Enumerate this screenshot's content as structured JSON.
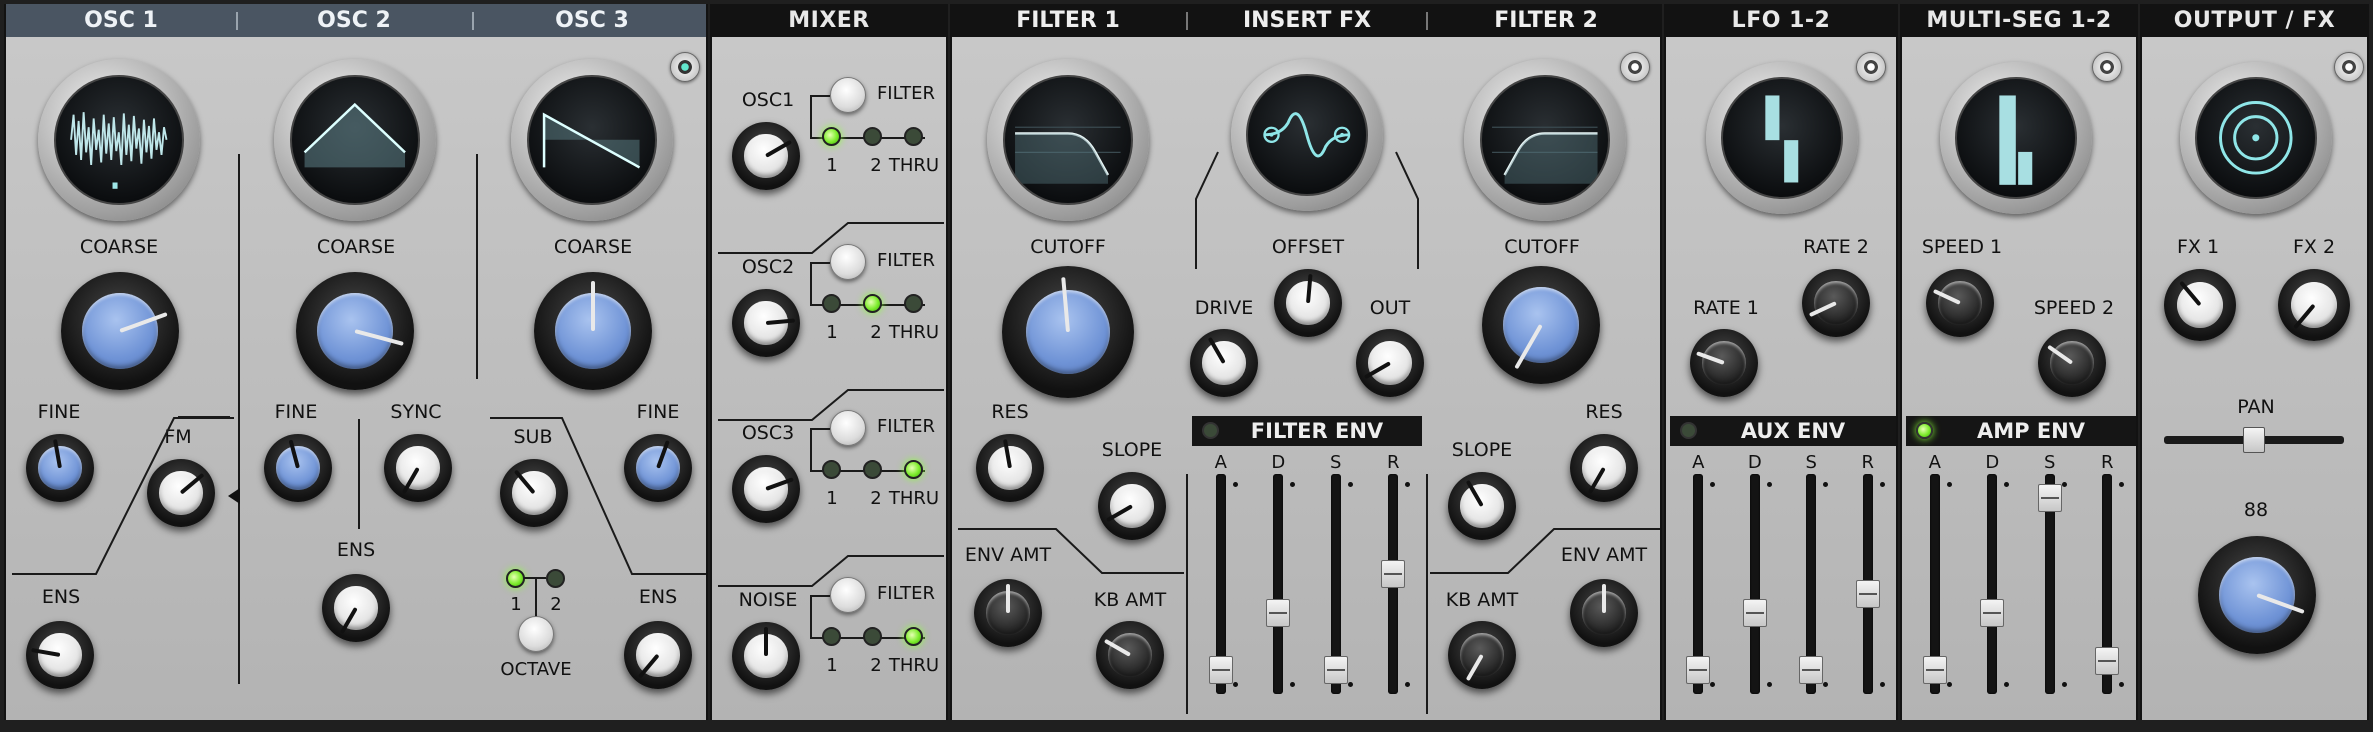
{
  "osc_header": {
    "osc1": "OSC 1",
    "osc2": "OSC 2",
    "osc3": "OSC 3"
  },
  "headers": {
    "mixer": "MIXER",
    "filter1": "FILTER 1",
    "insert_fx": "INSERT FX",
    "filter2": "FILTER 2",
    "lfo": "LFO 1-2",
    "multiseg": "MULTI-SEG 1-2",
    "output": "OUTPUT / FX"
  },
  "osc1": {
    "coarse": "COARSE",
    "fine": "FINE",
    "fm": "FM",
    "ens": "ENS"
  },
  "osc2": {
    "coarse": "COARSE",
    "fine": "FINE",
    "sync": "SYNC",
    "ens": "ENS"
  },
  "osc3": {
    "coarse": "COARSE",
    "sub": "SUB",
    "fine": "FINE",
    "ens": "ENS",
    "octave": "OCTAVE",
    "oct1": "1",
    "oct2": "2"
  },
  "mixer": {
    "rows": [
      {
        "name": "OSC1",
        "filter": "FILTER",
        "r1": "1",
        "r2": "2",
        "thru": "THRU",
        "active": 0
      },
      {
        "name": "OSC2",
        "filter": "FILTER",
        "r1": "1",
        "r2": "2",
        "thru": "THRU",
        "active": 1
      },
      {
        "name": "OSC3",
        "filter": "FILTER",
        "r1": "1",
        "r2": "2",
        "thru": "THRU",
        "active": 2
      },
      {
        "name": "NOISE",
        "filter": "FILTER",
        "r1": "1",
        "r2": "2",
        "thru": "THRU",
        "active": 2
      }
    ]
  },
  "filter1": {
    "cutoff": "CUTOFF",
    "res": "RES",
    "slope": "SLOPE",
    "env_amt": "ENV AMT",
    "kb_amt": "KB AMT"
  },
  "insert_fx": {
    "offset": "OFFSET",
    "drive": "DRIVE",
    "out": "OUT"
  },
  "filter2": {
    "cutoff": "CUTOFF",
    "res": "RES",
    "slope": "SLOPE",
    "env_amt": "ENV AMT",
    "kb_amt": "KB AMT"
  },
  "filter_env": {
    "title": "FILTER ENV",
    "a": "A",
    "d": "D",
    "s": "S",
    "r": "R",
    "levels": [
      0.05,
      0.35,
      0.05,
      0.55
    ]
  },
  "lfo": {
    "rate1": "RATE 1",
    "rate2": "RATE 2"
  },
  "aux_env": {
    "title": "AUX ENV",
    "a": "A",
    "d": "D",
    "s": "S",
    "r": "R",
    "levels": [
      0.05,
      0.35,
      0.05,
      0.45
    ]
  },
  "multiseg": {
    "speed1": "SPEED 1",
    "speed2": "SPEED 2"
  },
  "amp_env": {
    "title": "AMP ENV",
    "a": "A",
    "d": "D",
    "s": "S",
    "r": "R",
    "levels": [
      0.05,
      0.35,
      0.95,
      0.1
    ]
  },
  "output": {
    "fx1": "FX 1",
    "fx2": "FX 2",
    "pan": "PAN",
    "volume": "88"
  },
  "colors": {
    "accent_blue": "#6f93d6",
    "led_green": "#7cec2b",
    "screen_teal": "#8fe6e8",
    "header_osc": "#4a5562"
  }
}
